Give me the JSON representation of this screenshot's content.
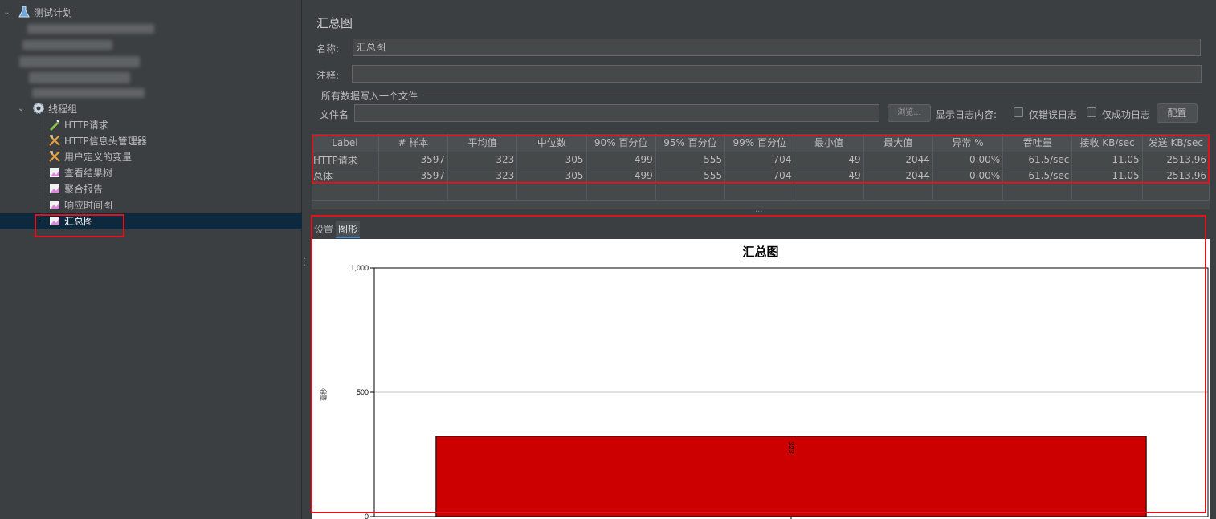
{
  "tree": {
    "root_label": "测试计划",
    "thread_group_label": "线程组",
    "items": [
      {
        "label": "HTTP请求",
        "icon": "pipette-icon"
      },
      {
        "label": "HTTP信息头管理器",
        "icon": "wrench-icon"
      },
      {
        "label": "用户定义的变量",
        "icon": "wrench-icon"
      },
      {
        "label": "查看结果树",
        "icon": "graph-icon"
      },
      {
        "label": "聚合报告",
        "icon": "graph-icon"
      },
      {
        "label": "响应时间图",
        "icon": "graph-icon"
      },
      {
        "label": "汇总图",
        "icon": "graph-icon"
      }
    ]
  },
  "panel": {
    "title": "汇总图",
    "name_label": "名称:",
    "name_value": "汇总图",
    "comment_label": "注释:",
    "comment_value": "",
    "file_section_label": "所有数据写入一个文件",
    "file_label": "文件名",
    "file_value": "",
    "browse_button": "浏览...",
    "log_content_label": "显示日志内容:",
    "errors_only_label": "仅错误日志",
    "success_only_label": "仅成功日志",
    "config_button": "配置"
  },
  "table": {
    "headers": [
      "Label",
      "# 样本",
      "平均值",
      "中位数",
      "90% 百分位",
      "95% 百分位",
      "99% 百分位",
      "最小值",
      "最大值",
      "异常 %",
      "吞吐量",
      "接收 KB/sec",
      "发送 KB/sec"
    ],
    "rows": [
      [
        "HTTP请求",
        "3597",
        "323",
        "305",
        "499",
        "555",
        "704",
        "49",
        "2044",
        "0.00%",
        "61.5/sec",
        "11.05",
        "2513.96"
      ],
      [
        "总体",
        "3597",
        "323",
        "305",
        "499",
        "555",
        "704",
        "49",
        "2044",
        "0.00%",
        "61.5/sec",
        "11.05",
        "2513.96"
      ]
    ]
  },
  "tabs": {
    "settings": "设置",
    "graph": "图形"
  },
  "chart_data": {
    "type": "bar",
    "title": "汇总图",
    "ylabel": "毫秒",
    "ylim": [
      0,
      1000
    ],
    "y_ticks": [
      "1,000",
      "500",
      "0"
    ],
    "categories": [
      ""
    ],
    "series": [
      {
        "values": [
          323
        ]
      }
    ],
    "value_label": "323",
    "bar_color": "#cc0000",
    "grid": true
  },
  "colors": {
    "background": "#3c3f41",
    "selection": "#0d293e",
    "highlight_box": "#e0141c",
    "bar": "#cc0000"
  }
}
